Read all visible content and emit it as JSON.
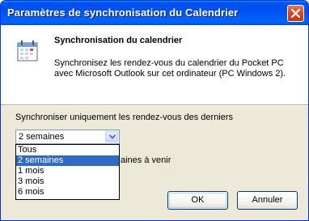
{
  "window": {
    "title": "Paramètres de synchronisation du Calendrier"
  },
  "header": {
    "title": "Synchronisation du calendrier",
    "description": "Synchronisez les rendez-vous du calendrier du Pocket PC avec Microsoft Outlook sur cet ordinateur (PC Windows 2)."
  },
  "sync": {
    "label": "Synchroniser uniquement les rendez-vous des derniers",
    "selected": "2 semaines",
    "options": [
      "Tous",
      "2 semaines",
      "1 mois",
      "3 mois",
      "6 mois"
    ],
    "upcoming_partial": "aines à venir"
  },
  "buttons": {
    "ok": "OK",
    "cancel": "Annuler"
  },
  "icons": {
    "close": "close-icon",
    "calendar": "calendar-icon",
    "dropdown": "chevron-down-icon"
  },
  "colors": {
    "titlebar": "#0053ee",
    "selection": "#316ac5",
    "dialog_bg": "#ece9d8",
    "close": "#d84a23"
  }
}
